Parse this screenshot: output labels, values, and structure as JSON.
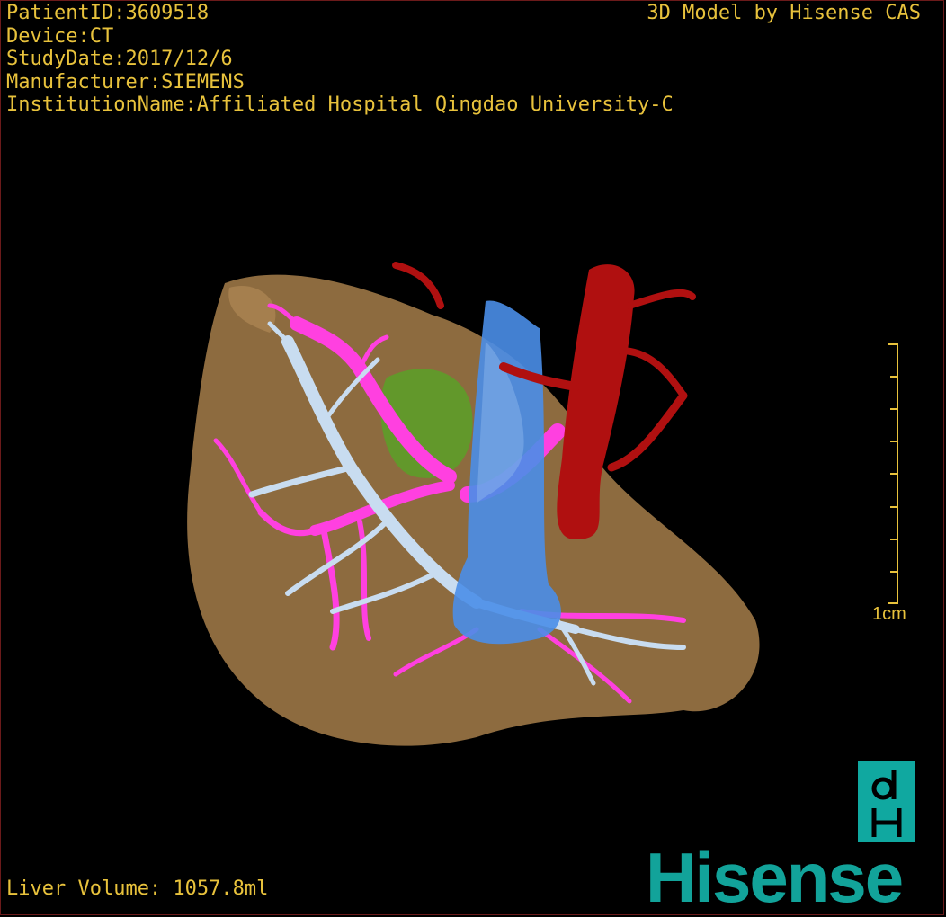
{
  "header": {
    "patient_id": "PatientID:3609518",
    "device": "Device:CT",
    "study_date": "StudyDate:2017/12/6",
    "manufacturer": "Manufacturer:SIEMENS",
    "institution": "InstitutionName:Affiliated Hospital Qingdao University-C"
  },
  "brand_caption": "3D Model by Hisense CAS",
  "footer": {
    "liver_volume": "Liver Volume: 1057.8ml"
  },
  "scale_bar": {
    "label": "1cm",
    "tick_count": 9
  },
  "logo": {
    "text": "Hisense",
    "mark_top": "d",
    "mark_bottom": "H"
  },
  "colors": {
    "overlay_text": "#e8c23c",
    "liver": "#a07a48",
    "portal_vein": "#ff40e0",
    "hepatic_vein": "#c8dcf0",
    "ivc": "#4a8ee8",
    "artery": "#b01010",
    "tumor": "#5aa028",
    "brand": "#12a39a"
  },
  "model_parts": [
    "liver",
    "hepatic-vein",
    "portal-vein",
    "inferior-vena-cava",
    "aorta",
    "lesion"
  ]
}
